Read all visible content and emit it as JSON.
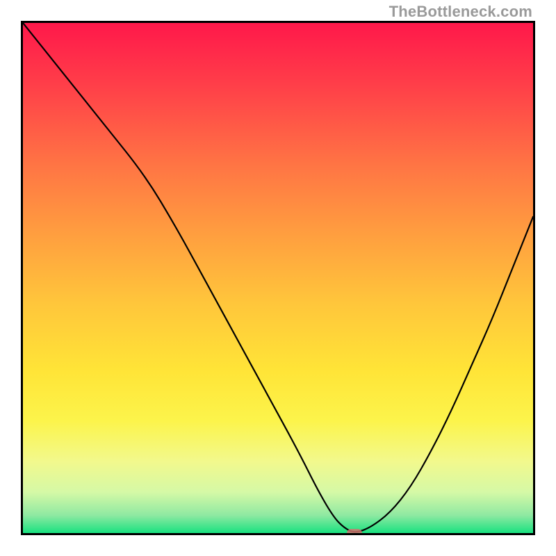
{
  "watermark": "TheBottleneck.com",
  "chart_data": {
    "type": "line",
    "title": "",
    "xlabel": "",
    "ylabel": "",
    "xlim": [
      0,
      100
    ],
    "ylim": [
      0,
      100
    ],
    "grid": false,
    "series": [
      {
        "name": "bottleneck-curve",
        "x": [
          0,
          8,
          16,
          24,
          30,
          36,
          42,
          48,
          54,
          58,
          61,
          63,
          65,
          68,
          72,
          76,
          80,
          84,
          88,
          92,
          96,
          100
        ],
        "values": [
          100,
          90,
          80,
          70,
          60,
          49,
          38,
          27,
          16,
          8,
          3,
          1,
          0,
          1,
          4,
          9,
          16,
          24,
          33,
          42,
          52,
          62
        ]
      }
    ],
    "marker": {
      "x": 65,
      "y": 0,
      "color": "#d6736f"
    },
    "gradient_stops": [
      {
        "offset": 0.0,
        "color": "#ff184a"
      },
      {
        "offset": 0.12,
        "color": "#ff3e49"
      },
      {
        "offset": 0.28,
        "color": "#ff7544"
      },
      {
        "offset": 0.42,
        "color": "#ffa03f"
      },
      {
        "offset": 0.55,
        "color": "#ffc63b"
      },
      {
        "offset": 0.68,
        "color": "#ffe437"
      },
      {
        "offset": 0.78,
        "color": "#fcf44b"
      },
      {
        "offset": 0.86,
        "color": "#f2f98d"
      },
      {
        "offset": 0.92,
        "color": "#d5f9a6"
      },
      {
        "offset": 0.965,
        "color": "#8fe9a2"
      },
      {
        "offset": 1.0,
        "color": "#19e180"
      }
    ]
  }
}
